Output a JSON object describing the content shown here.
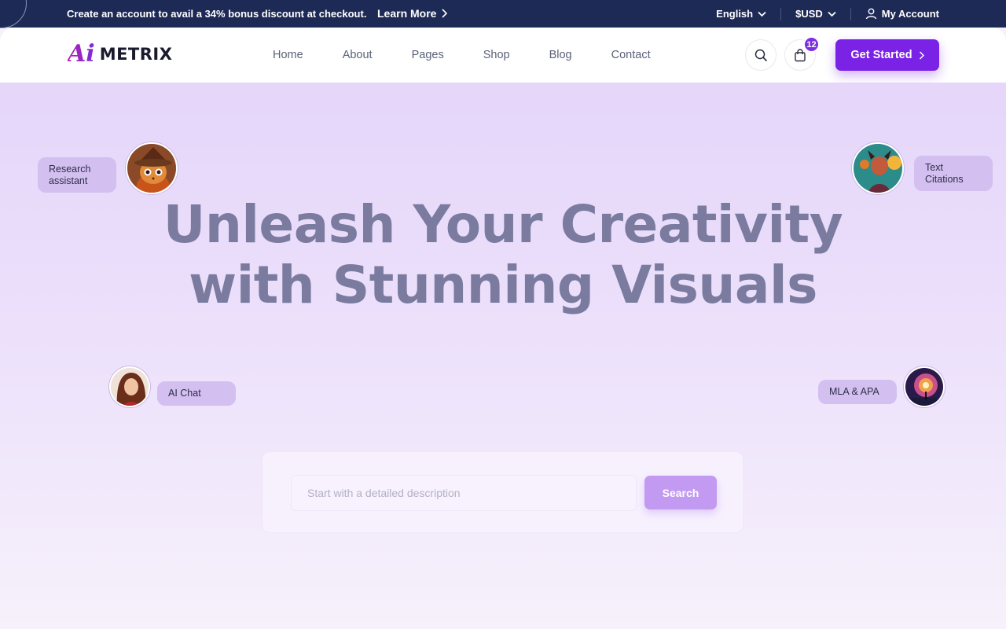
{
  "topbar": {
    "promo_text": "Create an account to avail a 34% bonus discount at checkout.",
    "learn_more": "Learn More",
    "language": "English",
    "currency": "$USD",
    "account": "My Account"
  },
  "header": {
    "logo_mark": "Ai",
    "logo_word": "METRIX",
    "nav": [
      "Home",
      "About",
      "Pages",
      "Shop",
      "Blog",
      "Contact"
    ],
    "cart_count": "12",
    "cta_label": "Get Started"
  },
  "hero": {
    "title_line1": "Unleash Your Creativity",
    "title_line2": "with Stunning Visuals",
    "pills": {
      "research": "Research assistant",
      "text_citations": "Text Citations",
      "ai_chat": "AI Chat",
      "mla_apa": "MLA & APA"
    },
    "search": {
      "placeholder": "Start with a detailed description",
      "value": "",
      "button": "Search"
    }
  },
  "colors": {
    "topbar_bg": "#1d2a55",
    "accent": "#7a22e6",
    "hero_bg": "#e5d6fa",
    "title": "#7a7b9e"
  }
}
